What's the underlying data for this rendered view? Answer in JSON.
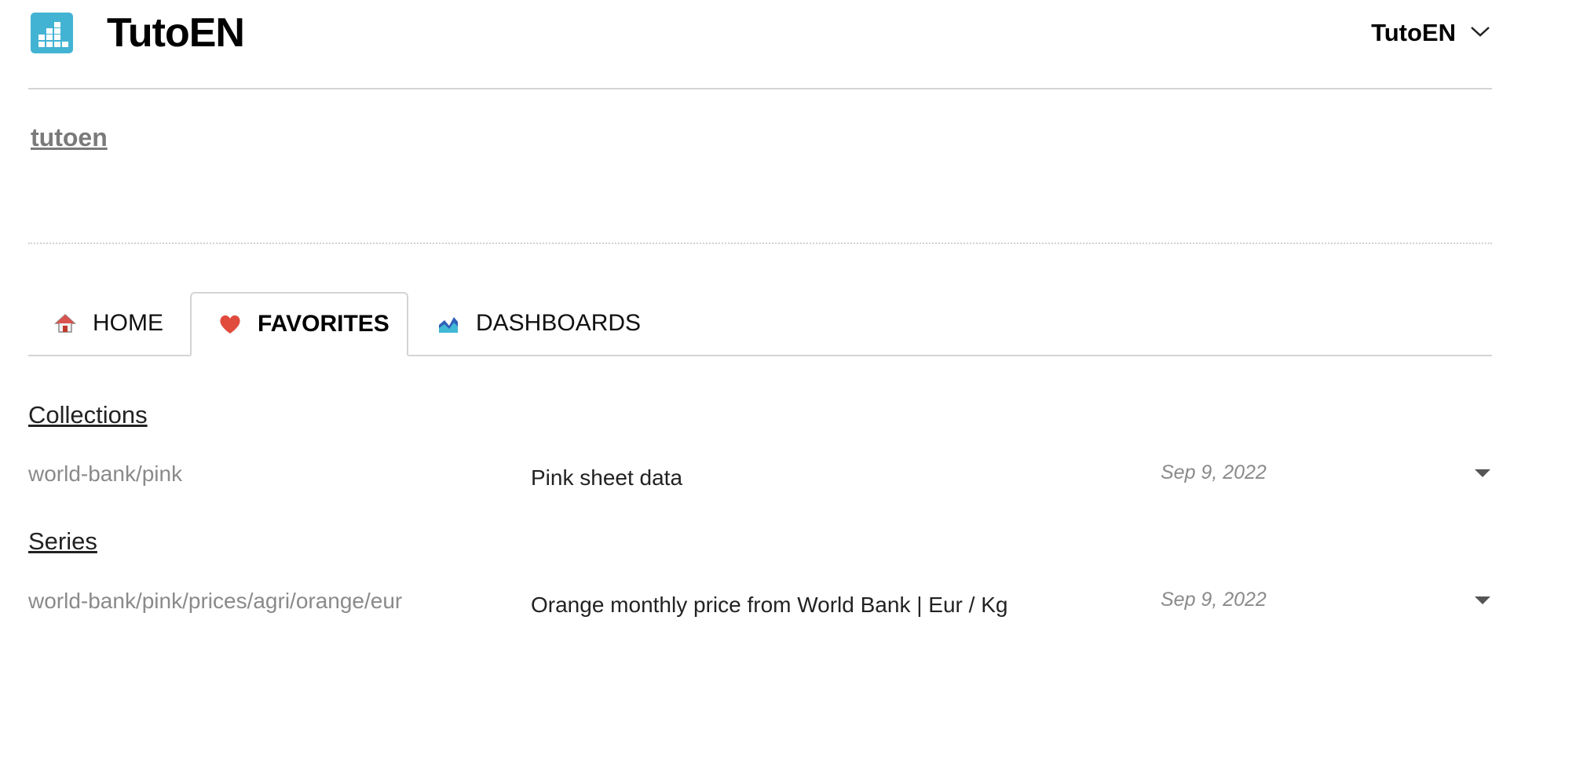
{
  "header": {
    "logo_icon": "bar-chart-logo-icon",
    "brand": "TutoEN",
    "user_menu": {
      "label": "TutoEN",
      "icon": "chevron-down-icon"
    }
  },
  "workspace": {
    "name": "tutoen"
  },
  "tabs": [
    {
      "label": "HOME",
      "icon": "house-icon",
      "active": false
    },
    {
      "label": "FAVORITES",
      "icon": "heart-icon",
      "active": true
    },
    {
      "label": "DASHBOARDS",
      "icon": "area-chart-icon",
      "active": false
    }
  ],
  "sections": {
    "collections": {
      "title": "Collections",
      "items": [
        {
          "path": "world-bank/pink",
          "description": "Pink sheet data",
          "date": "Sep 9, 2022"
        }
      ]
    },
    "series": {
      "title": "Series",
      "items": [
        {
          "path": "world-bank/pink/prices/agri/orange/eur",
          "description": "Orange monthly price from World Bank | Eur / Kg",
          "date": "Sep 9, 2022"
        }
      ]
    }
  },
  "colors": {
    "logo_bg": "#43b3d3",
    "heart": "#e04b3c",
    "muted_text": "#8a8a8a",
    "border": "#d4d4d4"
  }
}
